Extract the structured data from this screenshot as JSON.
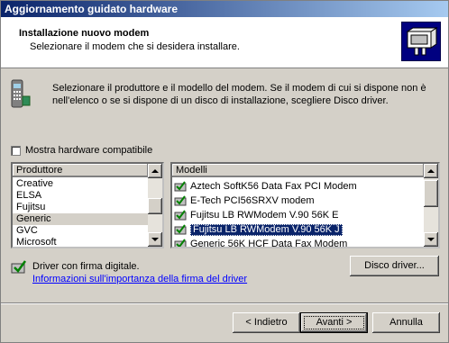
{
  "window": {
    "title": "Aggiornamento guidato hardware"
  },
  "header": {
    "title": "Installazione nuovo modem",
    "subtitle": "Selezionare il modem che si desidera installare."
  },
  "instructions": "Selezionare il produttore e il modello del modem. Se il modem di cui si dispone non è nell'elenco o se si dispone di un disco di installazione, scegliere Disco driver.",
  "compatible_checkbox": {
    "label": "Mostra hardware compatibile",
    "checked": false
  },
  "manufacturers": {
    "header": "Produttore",
    "items": [
      "Creative",
      "ELSA",
      "Fujitsu",
      "Generic",
      "GVC",
      "Microsoft"
    ],
    "selected": "Generic"
  },
  "models": {
    "header": "Modelli",
    "items": [
      "Aztech SoftK56 Data Fax PCI Modem",
      "E-Tech PCI56SRXV modem",
      "Fujitsu LB RWModem V.90 56K E",
      "Fujitsu LB RWModem V.90 56K J",
      "Generic 56K HCF Data Fax Modem"
    ],
    "selected": "Fujitsu LB RWModem V.90 56K J"
  },
  "signature": {
    "status": "Driver con firma digitale.",
    "link": "Informazioni sull'importanza della firma del driver"
  },
  "buttons": {
    "disk": "Disco driver...",
    "back": "< Indietro",
    "next": "Avanti >",
    "cancel": "Annulla"
  },
  "colors": {
    "title_bar_start": "#0a246a",
    "title_bar_end": "#a6caf0",
    "selection": "#0a246a",
    "link": "#0000ff",
    "dialog_face": "#d4d0c8"
  },
  "icons": {
    "header": "hardware-wizard-icon",
    "modem": "phone-modem-icon",
    "signed_driver": "signed-driver-icon"
  }
}
